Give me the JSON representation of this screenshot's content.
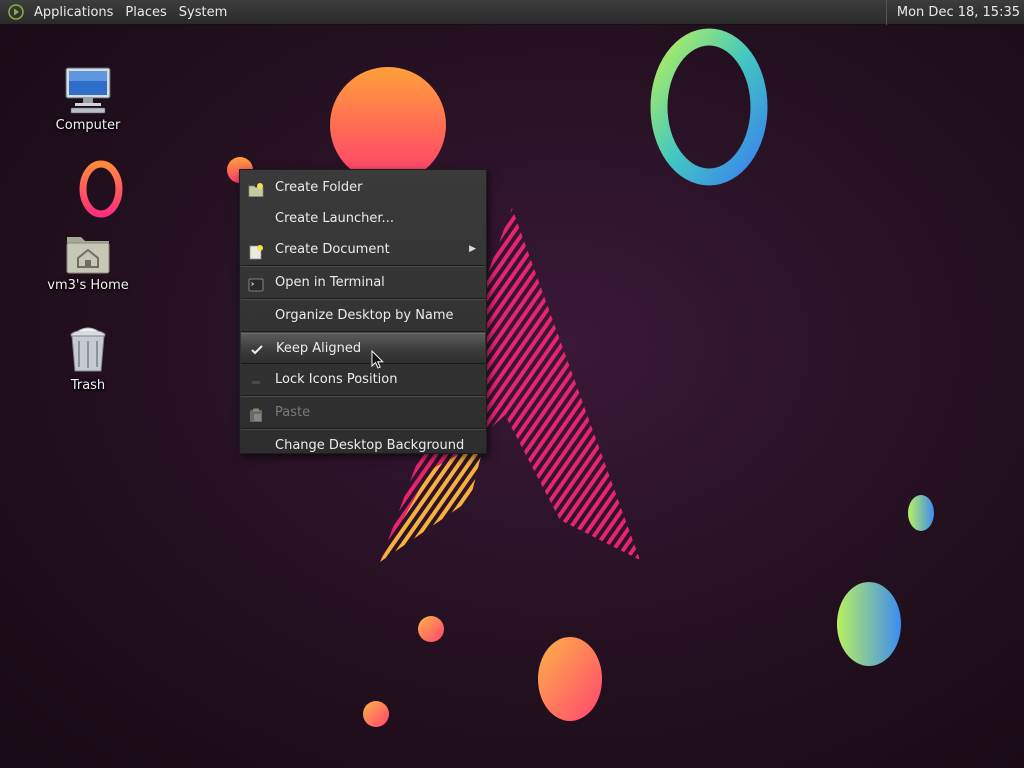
{
  "panel": {
    "menus": [
      "Applications",
      "Places",
      "System"
    ],
    "clock": "Mon Dec 18, 15:35"
  },
  "desktop": {
    "icons": [
      {
        "label": "Computer",
        "icon": "computer-icon"
      },
      {
        "label": "vm3's Home",
        "icon": "home-folder-icon"
      },
      {
        "label": "Trash",
        "icon": "trash-icon"
      }
    ]
  },
  "context_menu": {
    "items": [
      {
        "label": "Create Folder",
        "icon": "folder-new-icon",
        "enabled": true
      },
      {
        "label": "Create Launcher...",
        "icon": "",
        "enabled": true
      },
      {
        "label": "Create Document",
        "icon": "document-new-icon",
        "enabled": true,
        "submenu": true
      },
      {
        "label": "Open in Terminal",
        "icon": "terminal-icon",
        "enabled": true
      },
      {
        "label": "Organize Desktop by Name",
        "icon": "",
        "enabled": true
      },
      {
        "label": "Keep Aligned",
        "icon": "checkmark-icon",
        "enabled": true,
        "checked": true,
        "highlighted": true
      },
      {
        "label": "Lock Icons Position",
        "icon": "unchecked-icon",
        "enabled": true,
        "checked": false
      },
      {
        "label": "Paste",
        "icon": "paste-icon",
        "enabled": false
      },
      {
        "label": "Change Desktop Background",
        "icon": "",
        "enabled": true
      }
    ]
  },
  "colors": {
    "panel_bg": "#333333",
    "menu_bg": "#343434",
    "wallpaper_bg": "#23101f",
    "accent_pink": "#e8246e",
    "accent_orange": "#f7803a"
  }
}
